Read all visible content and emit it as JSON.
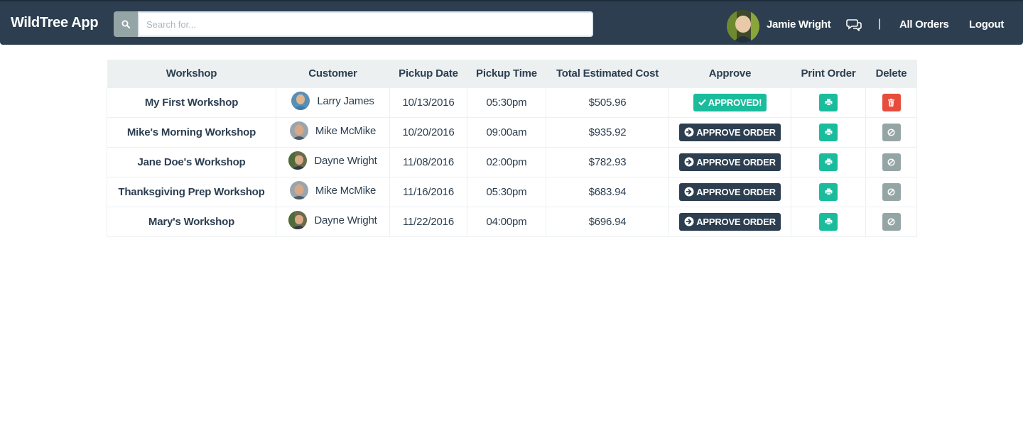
{
  "navbar": {
    "brand": "WildTree App",
    "search_placeholder": "Search for...",
    "user_name": "Jamie Wright",
    "separator": "|",
    "all_orders": "All Orders",
    "logout": "Logout"
  },
  "table": {
    "headers": [
      "Workshop",
      "Customer",
      "Pickup Date",
      "Pickup Time",
      "Total Estimated Cost",
      "Approve",
      "Print Order",
      "Delete"
    ],
    "rows": [
      {
        "workshop": "My First Workshop",
        "customer": "Larry James",
        "date": "10/13/2016",
        "time": "05:30pm",
        "cost": "$505.96",
        "approve": "APPROVED!"
      },
      {
        "workshop": "Mike's Morning Workshop",
        "customer": "Mike McMike",
        "date": "10/20/2016",
        "time": "09:00am",
        "cost": "$935.92",
        "approve": "APPROVE ORDER"
      },
      {
        "workshop": "Jane Doe's Workshop",
        "customer": "Dayne Wright",
        "date": "11/08/2016",
        "time": "02:00pm",
        "cost": "$782.93",
        "approve": "APPROVE ORDER"
      },
      {
        "workshop": "Thanksgiving Prep Workshop",
        "customer": "Mike McMike",
        "date": "11/16/2016",
        "time": "05:30pm",
        "cost": "$683.94",
        "approve": "APPROVE ORDER"
      },
      {
        "workshop": "Mary's Workshop",
        "customer": "Dayne Wright",
        "date": "11/22/2016",
        "time": "04:00pm",
        "cost": "$696.94",
        "approve": "APPROVE ORDER"
      }
    ]
  },
  "colors": {
    "navbar": "#2c3e50",
    "success": "#1abc9c",
    "danger": "#e74c3c",
    "disabled": "#95a5a6",
    "header_bg": "#ecf0f1"
  }
}
